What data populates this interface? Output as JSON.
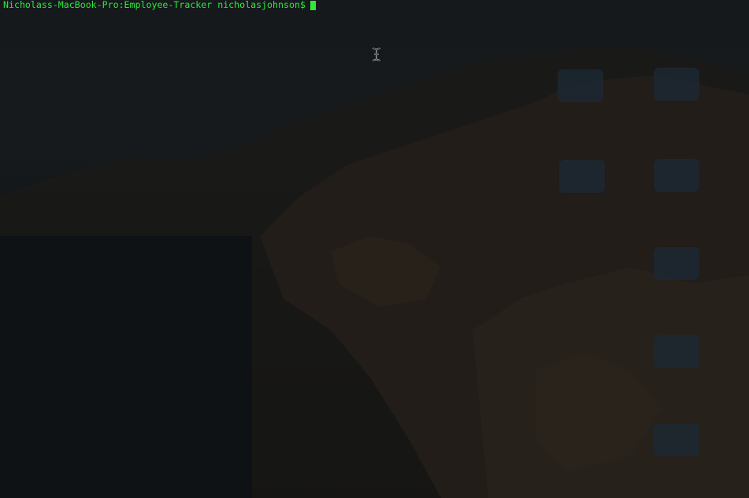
{
  "terminal": {
    "prompt": "Nicholass-MacBook-Pro:Employee-Tracker nicholasjohnson$",
    "colors": {
      "text": "#2fe83a",
      "background": "#0b0f12"
    }
  },
  "pointer": {
    "icon": "i-beam-cursor-icon"
  }
}
